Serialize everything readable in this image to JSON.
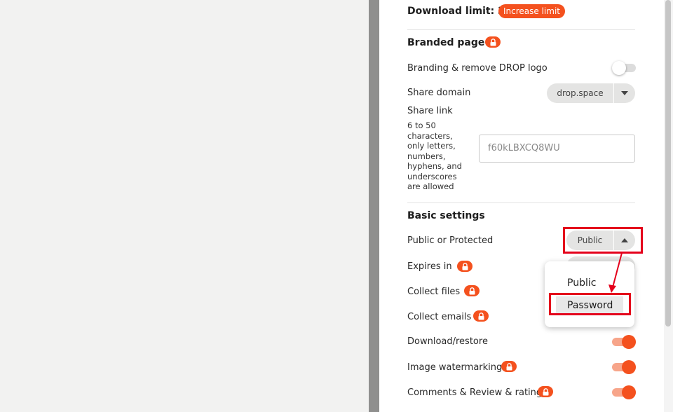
{
  "download_limit": {
    "label": "Download limit: 3",
    "increase_button": "Increase limit"
  },
  "branded_page": {
    "heading": "Branded page",
    "branding_label": "Branding & remove DROP logo",
    "share_domain_label": "Share domain",
    "share_domain_value": "drop.space",
    "share_link_label": "Share link",
    "share_link_help": [
      "6 to 50",
      "characters,",
      "only letters,",
      "numbers,",
      "hyphens, and",
      "underscores",
      "are allowed"
    ],
    "share_link_value": "f60kLBXCQ8WU"
  },
  "basic_settings": {
    "heading": "Basic settings",
    "public_or_protected": {
      "label": "Public or Protected",
      "value": "Public"
    },
    "expires_in": "Expires in",
    "collect_files": "Collect files",
    "collect_emails": "Collect emails",
    "download_restore": "Download/restore",
    "image_watermarking": "Image watermarking",
    "comments_review": "Comments & Review & rating"
  },
  "dropdown": {
    "options": [
      "Public",
      "Password"
    ],
    "highlighted": "Password"
  },
  "colors": {
    "accent": "#f4511e",
    "annotation": "#e4001b"
  }
}
